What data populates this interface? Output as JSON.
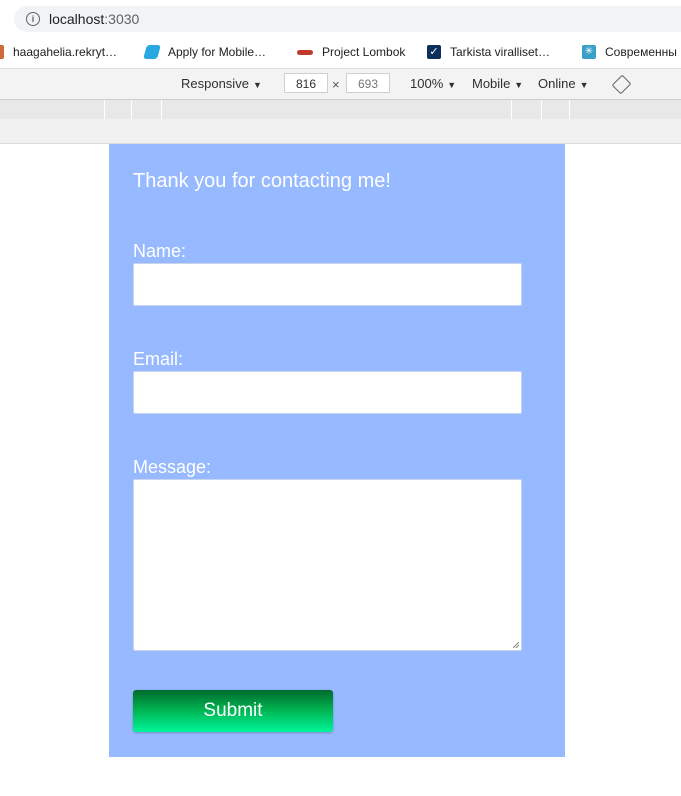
{
  "address_bar": {
    "host": "localhost",
    "port": ":3030"
  },
  "bookmarks": [
    {
      "label": "haagahelia.rekryt…",
      "icon": "bookmark-icon"
    },
    {
      "label": "Apply for Mobile…",
      "icon": "flutter-icon"
    },
    {
      "label": "Project Lombok",
      "icon": "chili-icon"
    },
    {
      "label": "Tarkista viralliset…",
      "icon": "check-icon"
    },
    {
      "label": "Современны",
      "icon": "star-icon"
    }
  ],
  "device_toolbar": {
    "mode": "Responsive",
    "width": "816",
    "height": "693",
    "zoom": "100%",
    "device_type": "Mobile",
    "network": "Online"
  },
  "form": {
    "heading": "Thank you for contacting me!",
    "name_label": "Name:",
    "name_value": "",
    "email_label": "Email:",
    "email_value": "",
    "message_label": "Message:",
    "message_value": "",
    "submit_label": "Submit"
  },
  "colors": {
    "panel": "#96b9ff",
    "submit_gradient": [
      "#006b2e",
      "#00f59a"
    ]
  }
}
